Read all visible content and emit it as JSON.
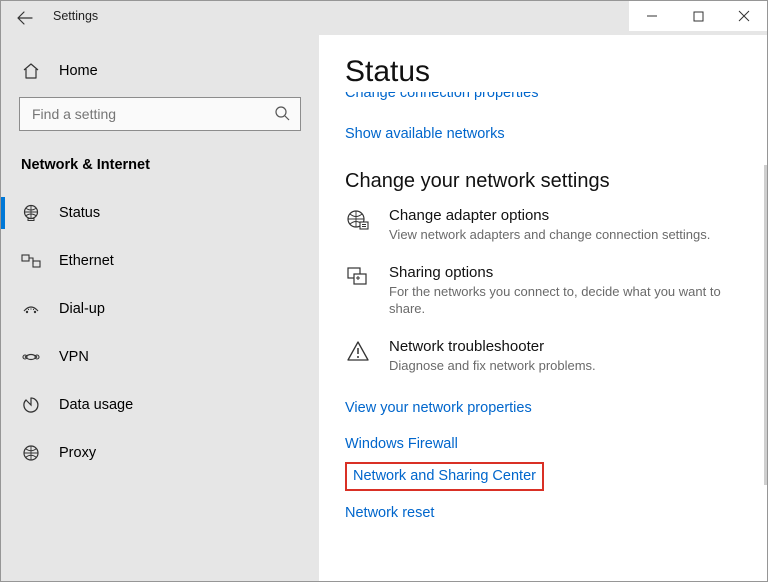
{
  "window": {
    "title": "Settings"
  },
  "sidebar": {
    "home": "Home",
    "search_placeholder": "Find a setting",
    "section": "Network & Internet",
    "items": [
      {
        "label": "Status",
        "icon": "status-icon",
        "selected": true
      },
      {
        "label": "Ethernet",
        "icon": "ethernet-icon",
        "selected": false
      },
      {
        "label": "Dial-up",
        "icon": "dialup-icon",
        "selected": false
      },
      {
        "label": "VPN",
        "icon": "vpn-icon",
        "selected": false
      },
      {
        "label": "Data usage",
        "icon": "datausage-icon",
        "selected": false
      },
      {
        "label": "Proxy",
        "icon": "proxy-icon",
        "selected": false
      }
    ]
  },
  "main": {
    "title": "Status",
    "cut_link": "Change connection properties",
    "link_show_networks": "Show available networks",
    "change_heading": "Change your network settings",
    "options": [
      {
        "title": "Change adapter options",
        "desc": "View network adapters and change connection settings."
      },
      {
        "title": "Sharing options",
        "desc": "For the networks you connect to, decide what you want to share."
      },
      {
        "title": "Network troubleshooter",
        "desc": "Diagnose and fix network problems."
      }
    ],
    "links": {
      "view_props": "View your network properties",
      "firewall": "Windows Firewall",
      "sharing_center": "Network and Sharing Center",
      "reset": "Network reset"
    }
  }
}
